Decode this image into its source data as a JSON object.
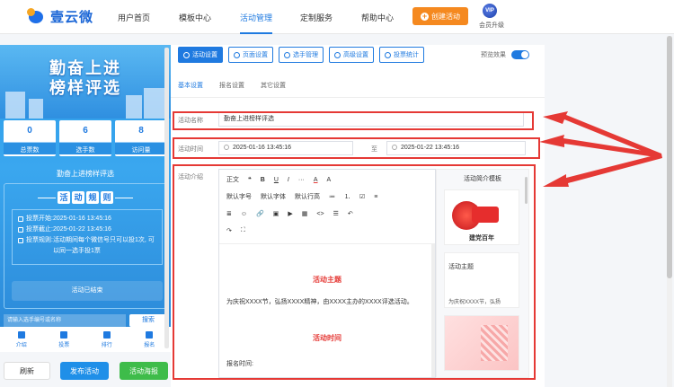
{
  "brand": {
    "name": "壹云微"
  },
  "nav": {
    "items": [
      "用户首页",
      "模板中心",
      "活动管理",
      "定制服务",
      "帮助中心"
    ],
    "create_label": "创建活动",
    "vip_label": "会员升级",
    "vip_badge": "VIP"
  },
  "preview": {
    "banner_line1": "勤奋上进",
    "banner_line2": "榜样评选",
    "stats": [
      {
        "value": "0",
        "label": "总票数"
      },
      {
        "value": "6",
        "label": "选手数"
      },
      {
        "value": "8",
        "label": "访问量"
      }
    ],
    "title": "勤奋上进榜样评选",
    "rules_chars": [
      "活",
      "动",
      "规",
      "则"
    ],
    "rules": [
      {
        "label": "投票开始:",
        "text": "2025-01-16 13:45:16"
      },
      {
        "label": "投票截止:",
        "text": "2025-01-22 13:45:16"
      },
      {
        "label": "投票规则:",
        "text": "活动期间每个微信号只可以投1次, 可以同一选手投1票"
      }
    ],
    "ended_label": "活动已结束",
    "search_placeholder": "请输入选手编号或名称",
    "search_button": "搜索",
    "bottom_nav": [
      "介绍",
      "投票",
      "排行",
      "报名"
    ]
  },
  "actions": {
    "refresh": "刷新",
    "publish": "发布活动",
    "poster": "活动海报"
  },
  "tabs": [
    "活动设置",
    "页面设置",
    "选手管理",
    "高级设置",
    "投票统计"
  ],
  "preview_toggle_label": "预览效果",
  "subtabs": [
    "基本设置",
    "报名设置",
    "其它设置"
  ],
  "form": {
    "name_label": "活动名称",
    "name_value": "勤奋上进榜样评选",
    "time_label": "活动时间",
    "start": "2025-01-16 13:45:16",
    "to": "至",
    "end": "2025-01-22 13:45:16",
    "intro_label": "活动介绍"
  },
  "toolbar": {
    "row1": [
      "正文",
      "❝",
      "B",
      "U",
      "I",
      "···",
      "A",
      "A"
    ],
    "row2": [
      "默认字号",
      "默认字体",
      "默认行高",
      "≔",
      "⒈",
      "☑",
      "≡"
    ],
    "row3": [
      "≣",
      "☺",
      "🔗",
      "▣",
      "▶",
      "▦",
      "<>",
      "☰",
      "↶"
    ],
    "row4": [
      "↷",
      "⛶"
    ]
  },
  "editor": {
    "heading1": "活动主题",
    "paragraph1": "为庆祝XXXX节，弘扬XXXX精神，由XXXX主办的XXXX评选活动。",
    "heading2": "活动时间",
    "paragraph2": "报名时间:"
  },
  "templates": {
    "title": "活动简介模板",
    "card1_caption": "建党百年",
    "card2_title": "活动主题",
    "card2_text": "为庆祝XXXX节，弘扬"
  }
}
